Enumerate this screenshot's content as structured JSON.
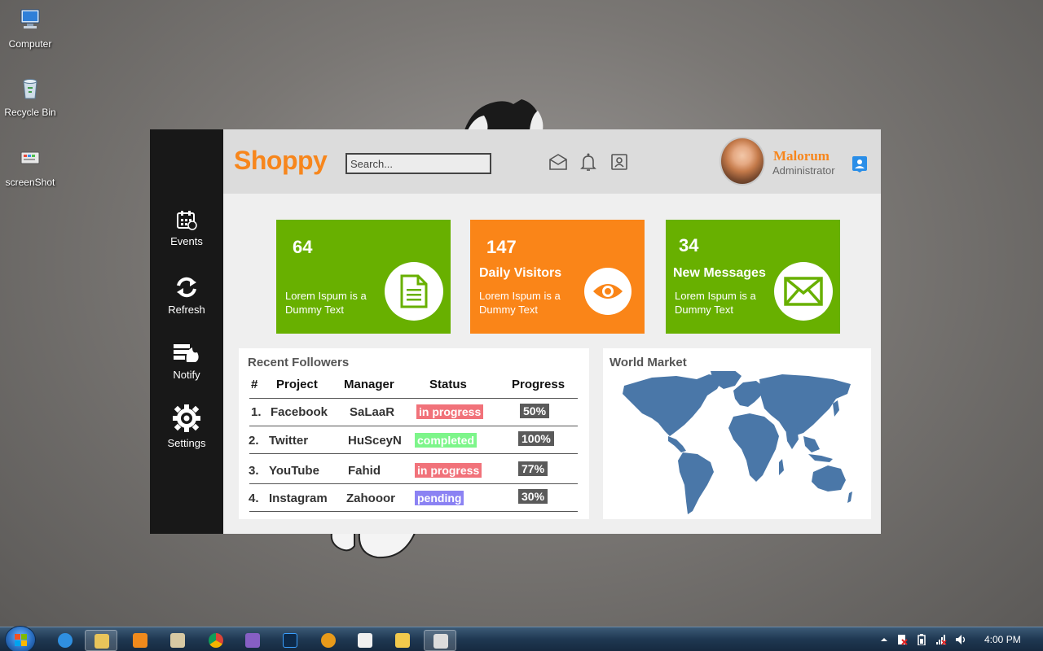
{
  "desktop": {
    "icons": [
      {
        "label": "Computer"
      },
      {
        "label": "Recycle Bin"
      },
      {
        "label": "screenShot"
      }
    ]
  },
  "sidebar": {
    "items": [
      {
        "label": "Events",
        "icon": "calendar-icon"
      },
      {
        "label": "Refresh",
        "icon": "refresh-icon"
      },
      {
        "label": "Notify",
        "icon": "notify-icon"
      },
      {
        "label": "Settings",
        "icon": "gear-icon"
      }
    ]
  },
  "header": {
    "brand": "Shoppy",
    "search_placeholder": "Search...",
    "user_name": "Malorum",
    "user_role": "Administrator"
  },
  "cards": [
    {
      "number": "64",
      "title": "",
      "desc": "Lorem Ispum is a Dummy Text",
      "color": "#68b000",
      "icon": "document-icon"
    },
    {
      "number": "147",
      "title": "Daily Visitors",
      "desc": "Lorem Ispum is a Dummy Text",
      "color": "#fa8518",
      "icon": "eye-icon"
    },
    {
      "number": "34",
      "title": "New Messages",
      "desc": "Lorem Ispum is a Dummy Text",
      "color": "#68b000",
      "icon": "envelope-icon"
    }
  ],
  "followers": {
    "title": "Recent Followers",
    "headers": [
      "#",
      "Project",
      "Manager",
      "Status",
      "Progress"
    ],
    "rows": [
      {
        "num": "1.",
        "project": "Facebook",
        "manager": "SaLaaR",
        "status": "in progress",
        "progress": "50%"
      },
      {
        "num": "2.",
        "project": "Twitter",
        "manager": "HuSceyN",
        "status": "completed",
        "progress": "100%"
      },
      {
        "num": "3.",
        "project": "YouTube",
        "manager": "Fahid",
        "status": "in progress",
        "progress": "77%"
      },
      {
        "num": "4.",
        "project": "Instagram",
        "manager": "Zahooor",
        "status": "pending",
        "progress": "30%"
      }
    ]
  },
  "market": {
    "title": "World Market"
  },
  "taskbar": {
    "clock": "4:00 PM"
  },
  "colors": {
    "accent_orange": "#f7861c",
    "accent_green": "#68b000",
    "sidebar": "#181818",
    "map_blue": "#4a77a8",
    "status_progress": "#f1727a",
    "status_completed": "#7df58a",
    "status_pending": "#8b82f3"
  }
}
